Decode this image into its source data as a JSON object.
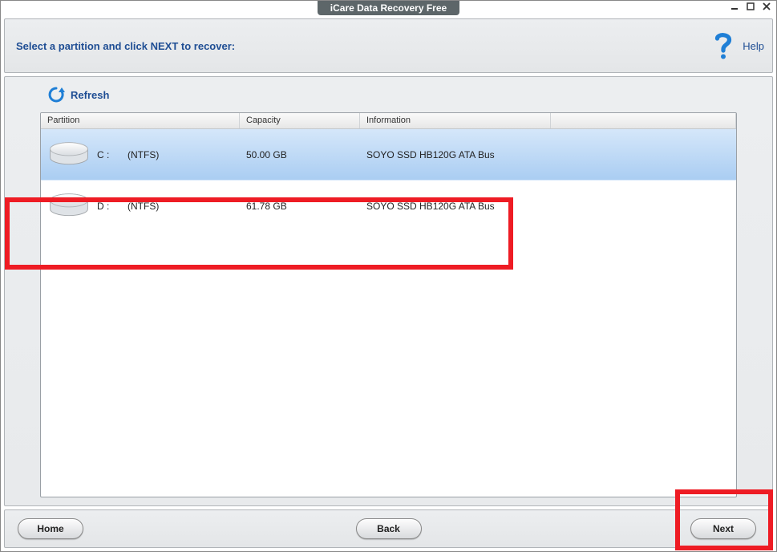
{
  "window": {
    "title": "iCare Data Recovery Free",
    "controls": {
      "minimize": "_",
      "maximize": "▢",
      "close": "×"
    }
  },
  "instruction": {
    "text": "Select a partition and click NEXT to recover:",
    "help_label": "Help"
  },
  "toolbar": {
    "refresh_label": "Refresh"
  },
  "table": {
    "columns": {
      "partition": "Partition",
      "capacity": "Capacity",
      "information": "Information"
    },
    "rows": [
      {
        "drive_letter": "C :",
        "fs": "(NTFS)",
        "capacity": "50.00 GB",
        "info": "SOYO SSD HB120G  ATA Bus",
        "selected": true
      },
      {
        "drive_letter": "D :",
        "fs": "(NTFS)",
        "capacity": "61.78 GB",
        "info": "SOYO SSD HB120G  ATA Bus",
        "selected": false
      }
    ]
  },
  "footer": {
    "home": "Home",
    "back": "Back",
    "next": "Next"
  },
  "highlights": {
    "row": true,
    "next": true
  }
}
